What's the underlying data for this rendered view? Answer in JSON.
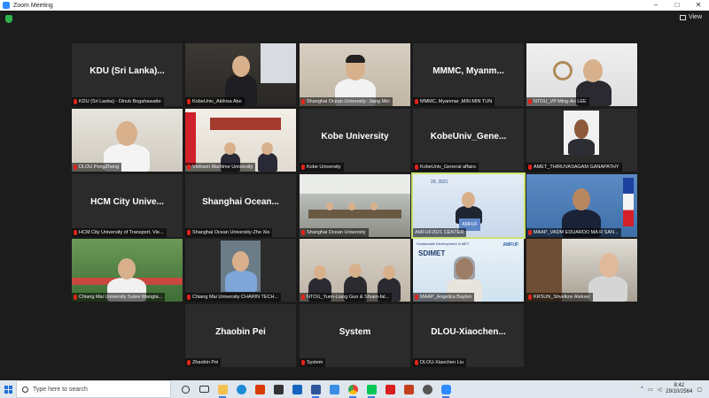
{
  "window": {
    "title": "Zoom Meeting",
    "minimize": "–",
    "maximize": "□",
    "close": "✕"
  },
  "view": {
    "label": "View"
  },
  "participants": [
    {
      "big_name": "KDU (Sri Lanka)...",
      "caption": "KDU (Sri Lanka) - Dinuk Bogahawatte"
    },
    {
      "big_name": "",
      "caption": "KobeUniv_Akihisa Abe"
    },
    {
      "big_name": "",
      "caption": "Shanghai Ocean University- Jiang Min"
    },
    {
      "big_name": "MMMC, Myanm...",
      "caption": "MMMC, Myanmar ,MIN MIN TUN"
    },
    {
      "big_name": "",
      "caption": "NTOU_VP Ming-An LEE"
    },
    {
      "big_name": "",
      "caption": "DLOU PengZheng"
    },
    {
      "big_name": "",
      "caption": "Vietnam Maritime University"
    },
    {
      "big_name": "Kobe University",
      "caption": "Kobe University"
    },
    {
      "big_name": "KobeUniv_Gene...",
      "caption": "KobeUniv_General affairs"
    },
    {
      "big_name": "",
      "caption": "AMET_THIRUVASAGAM GANAPATHY"
    },
    {
      "big_name": "HCM City Unive...",
      "caption": "HCM City University of Transport, Vie..."
    },
    {
      "big_name": "Shanghai Ocean...",
      "caption": "Shanghai Ocean University-Zhe Xie"
    },
    {
      "big_name": "",
      "caption": "Shanghai Ocean University"
    },
    {
      "big_name": "",
      "caption": "AMFUF2021 CENTER"
    },
    {
      "big_name": "",
      "caption": "MAAP_VADM EDUARDO MA R SAN..."
    },
    {
      "big_name": "",
      "caption": "Chiang Mai University Sutee Wangta..."
    },
    {
      "big_name": "",
      "caption": "Chiang Mai University CHARIN TECH..."
    },
    {
      "big_name": "",
      "caption": "NTOU_Yuen-Liang Guo & Shuen-fal..."
    },
    {
      "big_name": "",
      "caption": "MAAP_Angelica Baylon"
    },
    {
      "big_name": "",
      "caption": "KRSUN_Shvelkov Aleksei"
    },
    {
      "big_name": "Zhaobin Pei",
      "caption": "Zhaobin Pei"
    },
    {
      "big_name": "System",
      "caption": "System"
    },
    {
      "big_name": "DLOU-Xiaochen...",
      "caption": "DLOU-Xiaochen Liu"
    }
  ],
  "scenes": {
    "amfuf_banner": "AMFUF",
    "amfuf_year": "29, 2021",
    "sdimet_title": "SDIMET",
    "sdimet_head": "Sustainable Development in MET",
    "sdimet_logo": "AMFUF"
  },
  "taskbar": {
    "search_placeholder": "Type here to search",
    "time": "8:42",
    "date": "29/10/2564"
  },
  "colors": {
    "active_border": "#c9e26b",
    "mic_muted": "#e2231a",
    "tile_bg": "#2b2b2b"
  }
}
